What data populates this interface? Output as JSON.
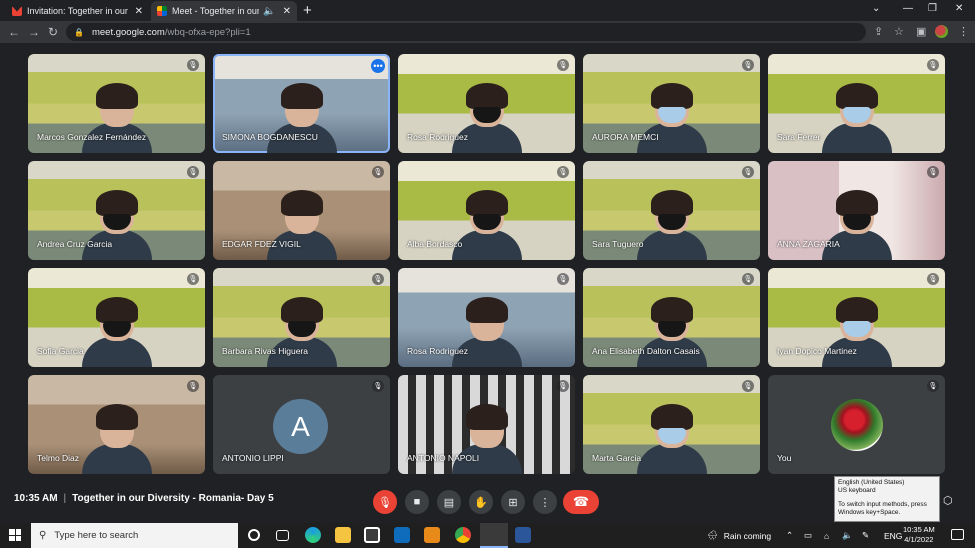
{
  "browser": {
    "tabs": [
      {
        "title": "Invitation: Together in our Diversi",
        "favicon": "gmail-icon",
        "active": false
      },
      {
        "title": "Meet - Together in our Divers",
        "favicon": "meet-icon",
        "active": true
      }
    ],
    "url_host": "meet.google.com",
    "url_path": "/wbq-ofxa-epe?pli=1"
  },
  "participants": [
    {
      "name": "Marcos Gonzalez Fernández",
      "muted": true,
      "bg": "bg-class",
      "mask": "none"
    },
    {
      "name": "SIMONA BOGDANESCU",
      "muted": false,
      "bg": "bg-room",
      "mask": "none",
      "pinned": true
    },
    {
      "name": "Rosa Rodriguez",
      "muted": true,
      "bg": "bg-class2",
      "mask": "black"
    },
    {
      "name": "AURORA MEMCI",
      "muted": true,
      "bg": "bg-class",
      "mask": "blue"
    },
    {
      "name": "Sara Ferrer",
      "muted": true,
      "bg": "bg-class2",
      "mask": "blue"
    },
    {
      "name": "Andrea Cruz Garcia",
      "muted": true,
      "bg": "bg-class",
      "mask": "black"
    },
    {
      "name": "EDGAR FDEZ VIGIL",
      "muted": true,
      "bg": "bg-wood",
      "mask": "none"
    },
    {
      "name": "Alba Bordasco",
      "muted": true,
      "bg": "bg-class2",
      "mask": "black"
    },
    {
      "name": "Sara Tuguero",
      "muted": true,
      "bg": "bg-class",
      "mask": "black"
    },
    {
      "name": "ANNA ZAGARIA",
      "muted": true,
      "bg": "bg-pink",
      "mask": "black"
    },
    {
      "name": "Sofia Garcia",
      "muted": true,
      "bg": "bg-class2",
      "mask": "black"
    },
    {
      "name": "Barbara Rivas Higuera",
      "muted": true,
      "bg": "bg-class",
      "mask": "black"
    },
    {
      "name": "Rosa Rodriguez",
      "muted": true,
      "bg": "bg-room",
      "mask": "none"
    },
    {
      "name": "Ana Elisabeth Dalton Casais",
      "muted": true,
      "bg": "bg-class",
      "mask": "black"
    },
    {
      "name": "Iyan Dopico Martinez",
      "muted": true,
      "bg": "bg-class2",
      "mask": "blue"
    },
    {
      "name": "Telmo Diaz",
      "muted": true,
      "bg": "bg-wood",
      "mask": "none"
    },
    {
      "name": "ANTONIO LIPPI",
      "muted": true,
      "bg": "dark",
      "avatar_letter": "A"
    },
    {
      "name": "ANTONIO NAPOLI",
      "muted": true,
      "bg": "bg-bars",
      "mask": "none"
    },
    {
      "name": "Marta Garcia",
      "muted": true,
      "bg": "bg-class",
      "mask": "blue"
    },
    {
      "name": "You",
      "muted": true,
      "bg": "dark",
      "avatar_image": "rose"
    }
  ],
  "meeting": {
    "time": "10:35 AM",
    "separator": "|",
    "title": "Together in our Diversity - Romania- Day 5"
  },
  "controls": {
    "mic": "mic-off-icon",
    "camera": "camera-icon",
    "captions": "captions-icon",
    "hand": "raise-hand-icon",
    "present": "present-icon",
    "more": "more-options-icon",
    "end": "end-call-icon"
  },
  "ime_tooltip": {
    "line1": "English (United States)",
    "line2": "US keyboard",
    "line3": "To switch input methods, press Windows key+Space."
  },
  "taskbar": {
    "search_placeholder": "Type here to search",
    "weather": "Rain coming",
    "lang": "ENG",
    "time": "10:35 AM",
    "date": "4/1/2022"
  }
}
